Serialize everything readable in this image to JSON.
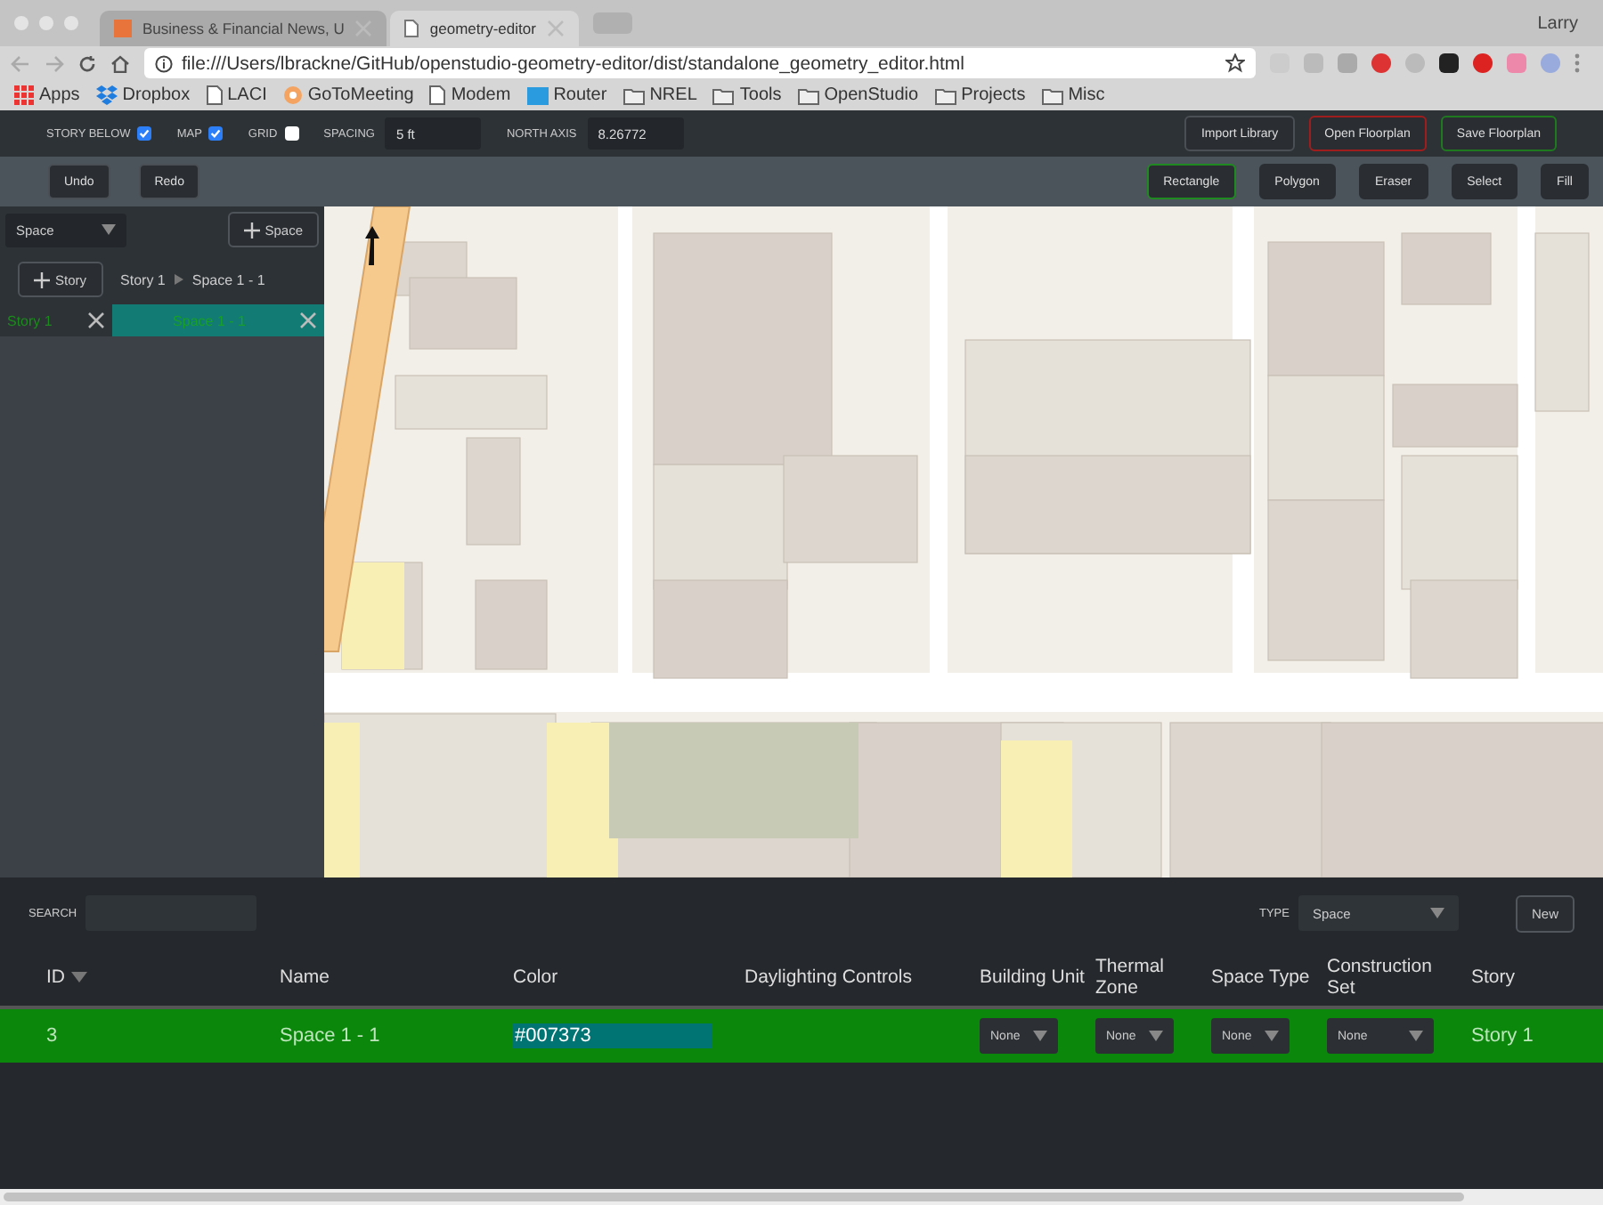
{
  "browser": {
    "tabs": [
      {
        "title": "Business & Financial News, U",
        "selected": false
      },
      {
        "title": "geometry-editor",
        "selected": true
      }
    ],
    "profile": "Larry",
    "address": "file:///Users/lbrackne/GitHub/openstudio-geometry-editor/dist/standalone_geometry_editor.html",
    "bookmarks": [
      {
        "label": "Apps",
        "kind": "apps"
      },
      {
        "label": "Dropbox",
        "kind": "dropbox"
      },
      {
        "label": "LACI",
        "kind": "page"
      },
      {
        "label": "GoToMeeting",
        "kind": "flower"
      },
      {
        "label": "Modem",
        "kind": "page"
      },
      {
        "label": "Router",
        "kind": "tp"
      },
      {
        "label": "NREL",
        "kind": "folder"
      },
      {
        "label": "Tools",
        "kind": "folder"
      },
      {
        "label": "OpenStudio",
        "kind": "folder"
      },
      {
        "label": "Projects",
        "kind": "folder"
      },
      {
        "label": "Misc",
        "kind": "folder"
      }
    ]
  },
  "toolbar": {
    "options": [
      {
        "label": "STORY BELOW",
        "checked": true
      },
      {
        "label": "MAP",
        "checked": true
      },
      {
        "label": "GRID",
        "checked": false
      }
    ],
    "fields": [
      {
        "label": "SPACING",
        "value": "5 ft"
      },
      {
        "label": "NORTH AXIS",
        "value": "8.26772"
      }
    ],
    "actions": [
      {
        "label": "Import Library",
        "kind": "plain"
      },
      {
        "label": "Open Floorplan",
        "kind": "danger"
      },
      {
        "label": "Save Floorplan",
        "kind": "success"
      }
    ]
  },
  "history": [
    "Undo",
    "Redo"
  ],
  "tools": [
    {
      "label": "Rectangle",
      "selected": true
    },
    {
      "label": "Polygon",
      "selected": false
    },
    {
      "label": "Eraser",
      "selected": false
    },
    {
      "label": "Select",
      "selected": false
    },
    {
      "label": "Fill",
      "selected": false
    }
  ],
  "sidebar": {
    "mode": "Space",
    "add_item": "Space",
    "add_story": "Story",
    "breadcrumb": [
      "Story 1",
      "Space 1 - 1"
    ],
    "stories": [
      {
        "name": "Story 1",
        "selected": true
      }
    ],
    "spaces": [
      {
        "name": "Space 1 - 1",
        "selected": true
      }
    ]
  },
  "inspector": {
    "search_label": "SEARCH",
    "type_label": "TYPE",
    "type_value": "Space",
    "new_button": "New",
    "columns": [
      {
        "label": "ID",
        "sorted": true
      },
      {
        "label": "Name",
        "sorted": false
      },
      {
        "label": "Color",
        "sorted": false
      },
      {
        "label": "Daylighting Controls",
        "sorted": false
      },
      {
        "label": "Building Unit",
        "sorted": false
      },
      {
        "label": "Thermal Zone",
        "sorted": false
      },
      {
        "label": "Space Type",
        "sorted": false
      },
      {
        "label": "Construction Set",
        "sorted": false
      },
      {
        "label": "Story",
        "sorted": false
      }
    ],
    "rows": [
      {
        "selected": true,
        "id": "3",
        "name": "Space 1 - 1",
        "color": "#007373",
        "building_unit": "None",
        "thermal_zone": "None",
        "space_type": "None",
        "construction_set": "None",
        "story": "Story 1"
      }
    ]
  }
}
